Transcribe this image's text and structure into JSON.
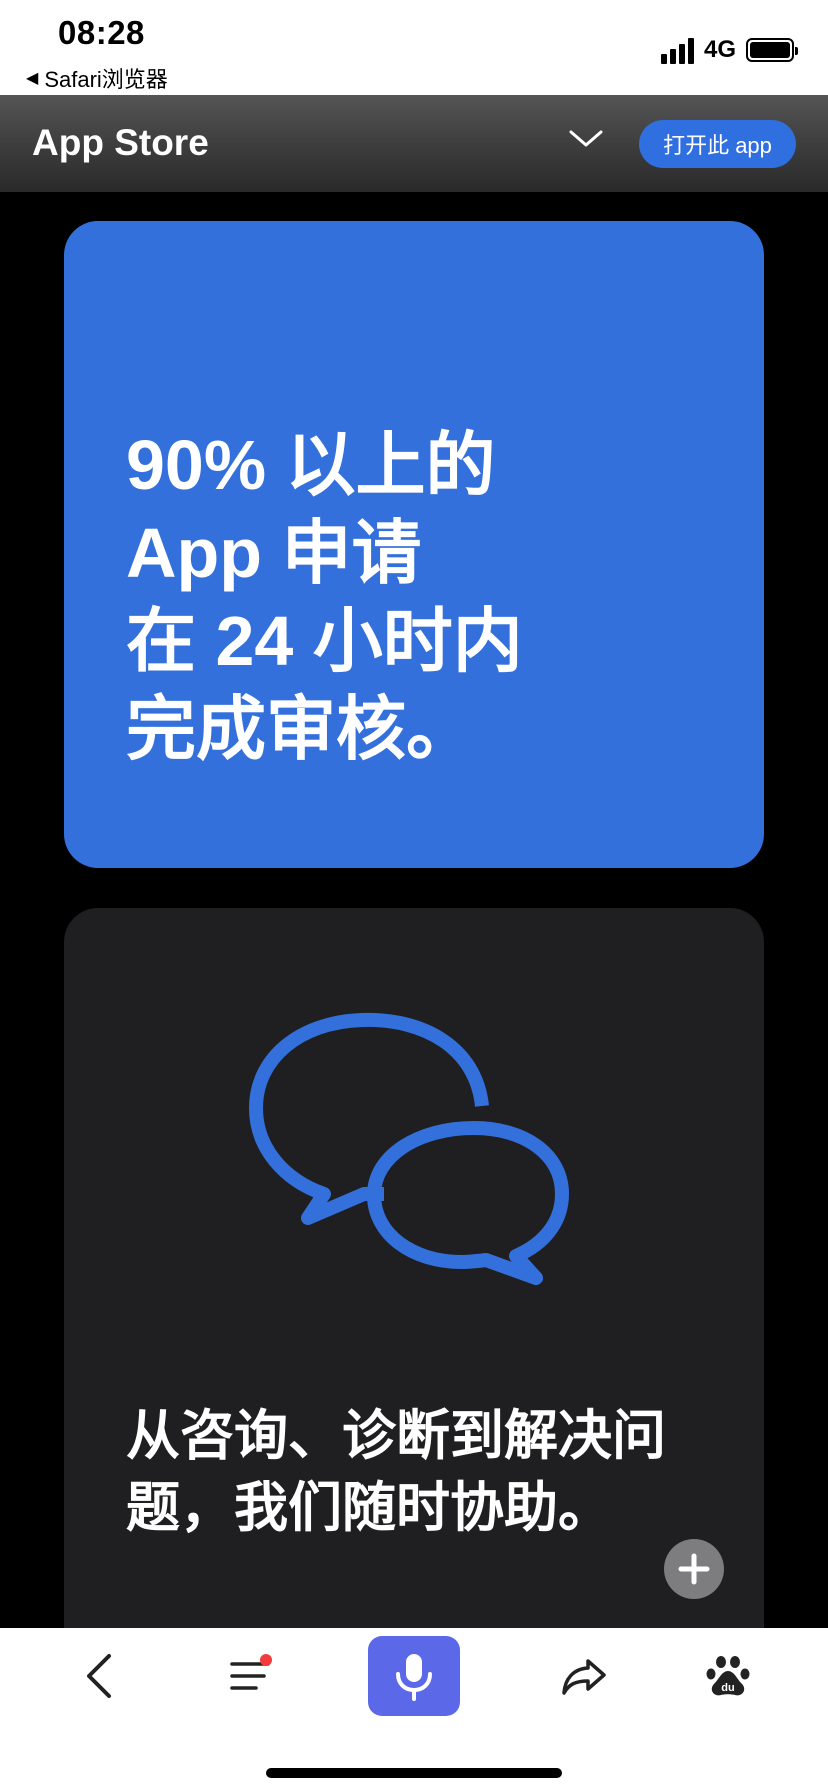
{
  "status_bar": {
    "time": "08:28",
    "back_app": "Safari浏览器",
    "network": "4G"
  },
  "header": {
    "title": "App Store",
    "open_button": "打开此 app"
  },
  "cards": {
    "review": {
      "line1": "90% 以上的",
      "line2": "App 申请",
      "line3": "在 24 小时内",
      "line4": "完成审核。"
    },
    "support": {
      "line1": "从咨询、诊断到解决问",
      "line2": "题，我们随时协助。"
    }
  },
  "toolbar": {
    "items": [
      "back-icon",
      "menu-icon",
      "microphone-icon",
      "share-icon",
      "baidu-paw-icon"
    ]
  },
  "colors": {
    "accent_blue": "#3370db",
    "button_blue": "#2f6fe0",
    "voice_button": "#5b68e8",
    "dark_card": "#1f1f21",
    "notification_dot": "#f23b3b"
  }
}
